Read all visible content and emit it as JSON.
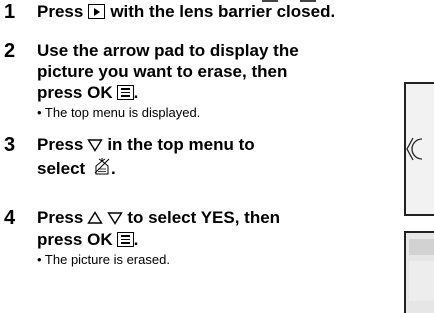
{
  "steps": [
    {
      "number": "1",
      "line1_a": "Press",
      "line1_b": "with the lens barrier closed."
    },
    {
      "number": "2",
      "line1": "Use the arrow pad to display the",
      "line2": "picture you want to erase, then",
      "line3_a": "press",
      "ok_label": "OK",
      "line3_end": ".",
      "note": "• The top menu is displayed."
    },
    {
      "number": "3",
      "line1_a": "Press",
      "line1_b": "in the top menu to",
      "line2_a": "select",
      "line2_end": "."
    },
    {
      "number": "4",
      "line1_a": "Press",
      "line1_b": "to select YES, then",
      "line2_a": "press",
      "ok_label": "OK",
      "line2_end": ".",
      "note": "• The picture is erased."
    }
  ],
  "icons": {
    "playback": "playback-button-icon",
    "menu": "menu-button-icon",
    "down": "down-arrow-icon",
    "up": "up-arrow-icon",
    "erase": "erase-icon"
  }
}
